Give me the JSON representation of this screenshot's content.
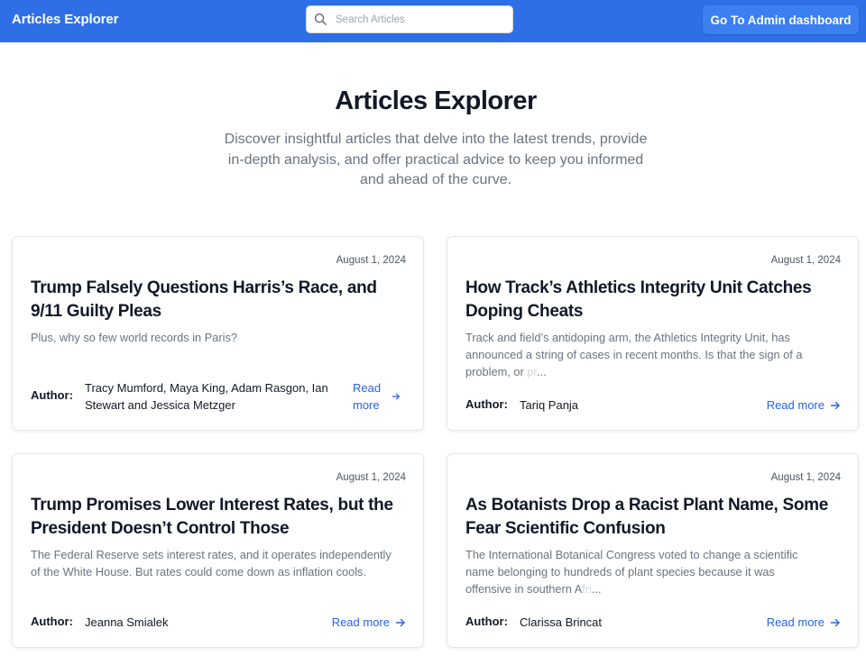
{
  "navbar": {
    "brand": "Articles Explorer",
    "search_placeholder": "Search Articles",
    "admin_button": "Go To Admin dashboard"
  },
  "hero": {
    "title": "Articles Explorer",
    "subtitle_lines": [
      "Discover insightful articles that delve into the latest trends, provide",
      "in-depth analysis, and offer practical advice to keep you informed",
      "and ahead of the curve."
    ]
  },
  "author_label": "Author:",
  "articles": [
    {
      "date": "August 1, 2024",
      "title_lines": [
        "Trump Falsely Questions Harris’s Race, and",
        "9/11 Guilty Pleas"
      ],
      "description_lines": [
        "Plus, why so few world records in Paris?"
      ],
      "author_lines": [
        "Tracy Mumford, Maya King, Adam Rasgon, Ian",
        "Stewart and Jessica Metzger"
      ],
      "read_more_lines": [
        "Read",
        "more"
      ]
    },
    {
      "date": "August 1, 2024",
      "title_lines": [
        "How Track’s Athletics Integrity Unit Catches",
        "Doping Cheats"
      ],
      "description_lines": [
        "Track and field’s antidoping arm, the Athletics Integrity Unit, has",
        "announced a string of cases in recent months. Is that the sign of a"
      ],
      "description_last_start": "problem, or ",
      "description_last_tail": "pr",
      "description_ellipsis": "...",
      "author_lines": [
        "Tariq Panja"
      ],
      "read_more": "Read more"
    },
    {
      "date": "August 1, 2024",
      "title_lines": [
        "Trump Promises Lower Interest Rates, but the",
        "President Doesn’t Control Those"
      ],
      "description_lines": [
        "The Federal Reserve sets interest rates, and it operates independently",
        "of the White House. But rates could come down as inflation cools."
      ],
      "author_lines": [
        "Jeanna Smialek"
      ],
      "read_more": "Read more"
    },
    {
      "date": "August 1, 2024",
      "title_lines": [
        "As Botanists Drop a Racist Plant Name, Some",
        "Fear Scientific Confusion"
      ],
      "description_lines": [
        "The International Botanical Congress voted to change a scientific",
        "name belonging to hundreds of plant species because it was"
      ],
      "description_last_start": "offensive in southern A",
      "description_last_tail": "fri",
      "description_ellipsis": "...",
      "author_lines": [
        "Clarissa Brincat"
      ],
      "read_more": "Read more"
    }
  ],
  "icons": {
    "search": "search-icon",
    "arrow": "arrow-right-icon"
  },
  "colors": {
    "navbar": "#2f6fe6",
    "admin_button": "#3b7ff0",
    "link": "#2563eb"
  }
}
